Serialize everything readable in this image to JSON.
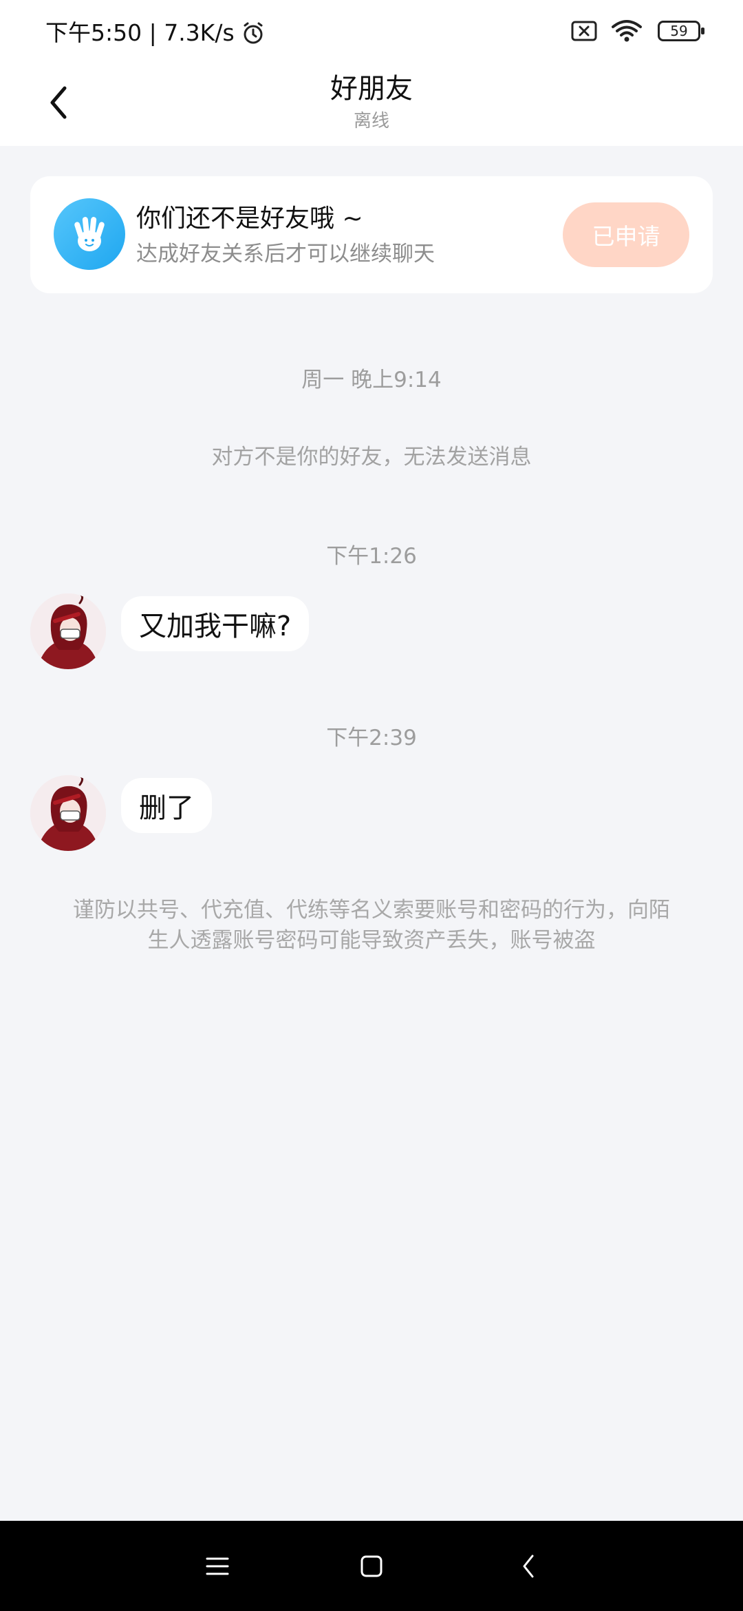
{
  "status_bar": {
    "time_speed": "下午5:50 | 7.3K/s",
    "battery": "59"
  },
  "header": {
    "title": "好朋友",
    "subtitle": "离线"
  },
  "friend_card": {
    "title": "你们还不是好友哦 ~",
    "subtitle": "达成好友关系后才可以继续聊天",
    "button_label": "已申请"
  },
  "chat": {
    "timestamp1": "周一 晚上9:14",
    "system_message": "对方不是你的好友，无法发送消息",
    "timestamp2": "下午1:26",
    "message1": "又加我干嘛?",
    "timestamp3": "下午2:39",
    "message2": "删了"
  },
  "warning": {
    "line1": "谨防以共号、代充值、代练等名义索要账号和密码的行为，向陌",
    "line2": "生人透露账号密码可能导致资产丢失，账号被盗"
  },
  "icons": {
    "alarm": "alarm-icon",
    "sim": "sim-off-icon",
    "wifi": "wifi-icon",
    "back": "chevron-left-icon",
    "wave": "hand-wave-icon",
    "menu": "menu-icon",
    "home": "home-icon",
    "nav_back": "nav-back-icon"
  },
  "colors": {
    "applied_button": "#ffd6c6",
    "hand_icon_bg": "#1fa7f0",
    "page_bg": "#f4f5f8"
  }
}
